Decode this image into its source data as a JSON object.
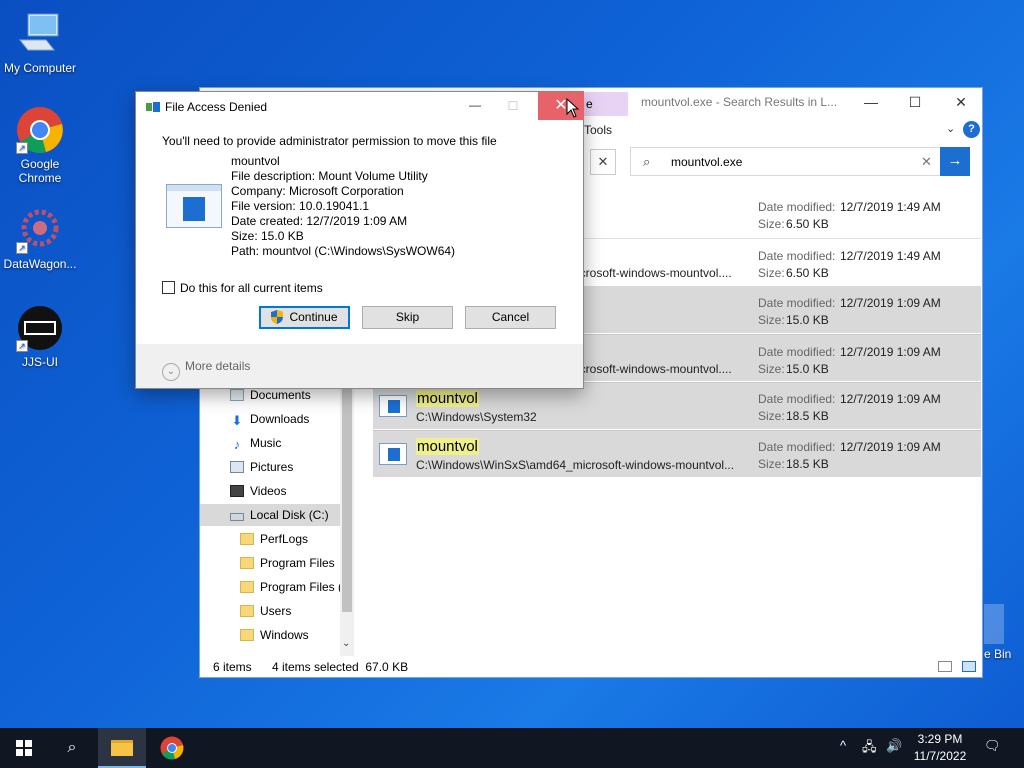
{
  "desktop": {
    "icons": [
      {
        "label": "My Computer"
      },
      {
        "label": "Google Chrome"
      },
      {
        "label": "DataWagon..."
      },
      {
        "label": "JJS-UI"
      }
    ],
    "recycle_bin_label": "e Bin"
  },
  "explorer": {
    "title": "mountvol.exe - Search Results in L...",
    "ribbon_tab": "e",
    "ribbon_tools": "Tools",
    "search_value": "mountvol.exe",
    "results": [
      {
        "name": "",
        "path": "",
        "date_label": "Date modified:",
        "date": "12/7/2019 1:49 AM",
        "size_label": "Size:",
        "size": "6.50 KB"
      },
      {
        "name": "",
        "path": "icrosoft-windows-mountvol....",
        "date_label": "Date modified:",
        "date": "12/7/2019 1:49 AM",
        "size_label": "Size:",
        "size": "6.50 KB"
      },
      {
        "name": "",
        "path": "",
        "date_label": "Date modified:",
        "date": "12/7/2019 1:09 AM",
        "size_label": "Size:",
        "size": "15.0 KB"
      },
      {
        "name": "",
        "path": "icrosoft-windows-mountvol....",
        "date_label": "Date modified:",
        "date": "12/7/2019 1:09 AM",
        "size_label": "Size:",
        "size": "15.0 KB"
      },
      {
        "name": "mountvol",
        "path": "C:\\Windows\\System32",
        "date_label": "Date modified:",
        "date": "12/7/2019 1:09 AM",
        "size_label": "Size:",
        "size": "18.5 KB"
      },
      {
        "name": "mountvol",
        "path": "C:\\Windows\\WinSxS\\amd64_microsoft-windows-mountvol...",
        "date_label": "Date modified:",
        "date": "12/7/2019 1:09 AM",
        "size_label": "Size:",
        "size": "18.5 KB"
      }
    ],
    "nav": [
      {
        "label": "Documents"
      },
      {
        "label": "Downloads"
      },
      {
        "label": "Music"
      },
      {
        "label": "Pictures"
      },
      {
        "label": "Videos"
      },
      {
        "label": "Local Disk (C:)"
      },
      {
        "label": "PerfLogs"
      },
      {
        "label": "Program Files"
      },
      {
        "label": "Program Files ("
      },
      {
        "label": "Users"
      },
      {
        "label": "Windows"
      }
    ],
    "status_items": "6 items",
    "status_selected": "4 items selected  67.0 KB"
  },
  "dialog": {
    "title": "File Access Denied",
    "heading": "You'll need to provide administrator permission to move this file",
    "file_name": "mountvol",
    "file_description": "File description: Mount Volume Utility",
    "company": "Company: Microsoft Corporation",
    "file_version": "File version: 10.0.19041.1",
    "date_created": "Date created: 12/7/2019 1:09 AM",
    "size": "Size: 15.0 KB",
    "path": "Path: mountvol (C:\\Windows\\SysWOW64)",
    "checkbox_label": "Do this for all current items",
    "continue_label": "Continue",
    "skip_label": "Skip",
    "cancel_label": "Cancel",
    "more_details": "More details"
  },
  "taskbar": {
    "time": "3:29 PM",
    "date": "11/7/2022"
  }
}
